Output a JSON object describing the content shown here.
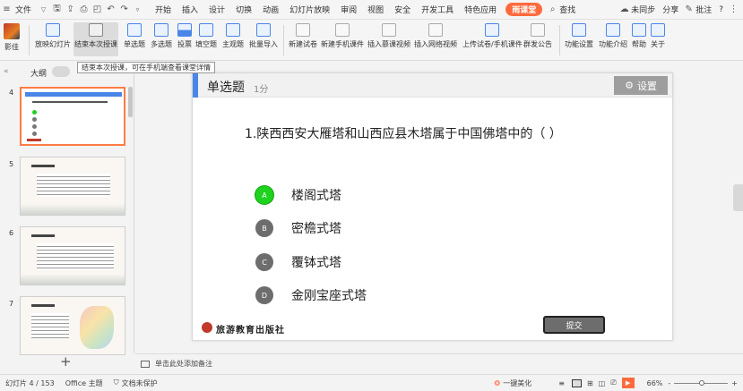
{
  "menubar": {
    "file": "文件",
    "tabs": [
      "开始",
      "插入",
      "设计",
      "切换",
      "动画",
      "幻灯片放映",
      "审阅",
      "视图",
      "安全",
      "开发工具",
      "特色应用"
    ],
    "active_tab": "雨课堂",
    "search": "查找",
    "sync": "未同步",
    "share": "分享",
    "comment": "批注",
    "help": "?"
  },
  "ribbon": {
    "brand": "影佳",
    "buttons": [
      "放映幻灯片",
      "结束本次授课",
      "单选题",
      "多选题",
      "投票",
      "填空题",
      "主观题",
      "批量导入",
      "新建试卷",
      "新建手机课件",
      "插入慕课视频",
      "插入网络视频",
      "上传试卷/手机课件",
      "群发公告",
      "功能设置",
      "功能介绍",
      "帮助",
      "关于"
    ],
    "tooltip": "结束本次授课，可在手机端查看课堂详情"
  },
  "sidebar": {
    "tab_outline": "大纲",
    "thumb_numbers": [
      "4",
      "5",
      "6",
      "7"
    ],
    "add": "+"
  },
  "slide": {
    "type_label": "单选题",
    "score": "1分",
    "settings": "设置",
    "question": "1.陕西西安大雁塔和山西应县木塔属于中国佛塔中的（    ）",
    "options": [
      {
        "key": "A",
        "text": "楼阁式塔",
        "selected": true
      },
      {
        "key": "B",
        "text": "密檐式塔",
        "selected": false
      },
      {
        "key": "C",
        "text": "覆钵式塔",
        "selected": false
      },
      {
        "key": "D",
        "text": "金刚宝座式塔",
        "selected": false
      }
    ],
    "publisher": "旅游教育出版社",
    "submit": "提交"
  },
  "notes": {
    "placeholder": "单击此处添加备注"
  },
  "status": {
    "slide_count": "幻灯片 4 / 153",
    "theme": "Office 主题",
    "protect": "文档未保护",
    "beautify": "一键美化",
    "zoom": "66%",
    "minus": "-",
    "plus": "+"
  },
  "colors": {
    "accent": "#ff6a3d",
    "selected_option": "#1ed21e",
    "slide_bar": "#4a86e8"
  }
}
